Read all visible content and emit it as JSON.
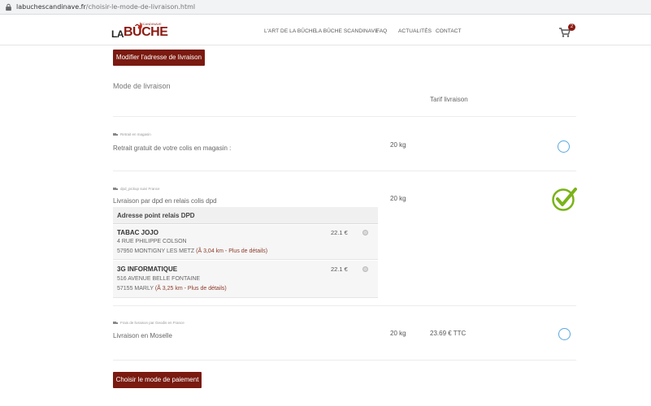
{
  "browser": {
    "url_host": "labuchescandinave.fr",
    "url_path": "/choisir-le-mode-de-livraison.html"
  },
  "header": {
    "logo_la": "LA",
    "logo_buche": "BÛCHE",
    "logo_scand": "SCANDINAVE",
    "nav": [
      "L'ART DE LA BÛCHE",
      "LA BÛCHE SCANDINAVE",
      "FAQ",
      "ACTUALITÉS",
      "CONTACT"
    ],
    "cart_count": "2"
  },
  "buttons": {
    "modify_address": "Modifier l'adresse de livraison",
    "choose_payment": "Choisir le mode de paiement"
  },
  "section": {
    "mode_heading": "Mode de livraison",
    "tarif_heading": "Tarif livraison"
  },
  "options": [
    {
      "small_label": "Retrait en magasin",
      "text": "Retrait gratuit de votre colis en magasin :",
      "weight": "20 kg",
      "price": "",
      "selected": false
    },
    {
      "small_label": "dpd_pickup suivi France",
      "text": "Livraison par dpd en relais colis dpd",
      "weight": "20 kg",
      "price": "",
      "selected": true
    },
    {
      "small_label": "Frais de livraison par Geodis en France",
      "text": "Livraison en Moselle",
      "weight": "20 kg",
      "price": "23.69 € TTC",
      "selected": false
    }
  ],
  "relay": {
    "heading": "Adresse point relais DPD",
    "points": [
      {
        "name": "TABAC JOJO",
        "street": "4 RUE PHILIPPE COLSON",
        "city": "57950 MONTIGNY LES METZ",
        "distance": "(Ã  3,04 km - Plus de détails)",
        "price": "22.1 €"
      },
      {
        "name": "3G INFORMATIQUE",
        "street": "516 AVENUE BELLE FONTAINE",
        "city": "57155 MARLY",
        "distance": "(Ã  3,25 km - Plus de détails)",
        "price": "22.1 €"
      }
    ]
  },
  "colors": {
    "brand": "#7a1a10",
    "radio": "#5aa7df",
    "check": "#7ab317"
  }
}
